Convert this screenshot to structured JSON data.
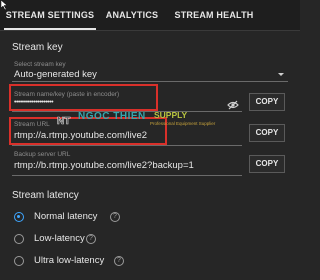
{
  "tabs": [
    {
      "label": "STREAM SETTINGS",
      "active": true
    },
    {
      "label": "ANALYTICS",
      "active": false
    },
    {
      "label": "STREAM HEALTH",
      "active": false
    }
  ],
  "stream_key": {
    "title": "Stream key",
    "select_label": "Select stream key",
    "select_value": "Auto-generated key",
    "key_label": "Stream name/key (paste in encoder)",
    "key_value": "••••••••••••••••••••",
    "copy_label": "COPY"
  },
  "stream_url": {
    "label": "Stream URL",
    "value": "rtmp://a.rtmp.youtube.com/live2",
    "copy_label": "COPY"
  },
  "backup_url": {
    "label": "Backup server URL",
    "value": "rtmp://b.rtmp.youtube.com/live2?backup=1",
    "copy_label": "COPY"
  },
  "latency": {
    "title": "Stream latency",
    "options": [
      {
        "label": "Normal latency",
        "selected": true,
        "help_icon": "help-icon"
      },
      {
        "label": "Low-latency",
        "selected": false,
        "help_icon": "help-icon"
      },
      {
        "label": "Ultra low-latency",
        "selected": false,
        "help_icon": "help-icon"
      }
    ]
  },
  "watermark": {
    "logo_text": "NT",
    "name": "NGOC THIEN",
    "supply": "SUPPLY",
    "tagline": "Professional Equipment Supplier"
  },
  "colors": {
    "background": "#262626",
    "accent": "#3ea6ff",
    "highlight_box": "#d9302a"
  }
}
